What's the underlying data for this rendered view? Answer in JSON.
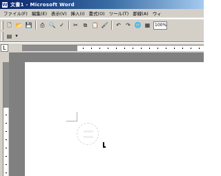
{
  "window": {
    "title": "文書1 - Microsoft Word",
    "app_icon": "word-app-icon"
  },
  "menu": {
    "items": [
      "ファイル(F)",
      "編集(E)",
      "表示(V)",
      "挿入(I)",
      "書式(O)",
      "ツール(T)",
      "罫線(A)",
      "ウィ"
    ]
  },
  "toolbar": {
    "standard_icons": [
      "new-document-icon",
      "open-folder-icon",
      "save-icon",
      "print-icon",
      "print-preview-icon",
      "spelling-icon",
      "cut-icon",
      "copy-icon",
      "paste-icon",
      "format-painter-icon",
      "undo-icon",
      "redo-icon",
      "hyperlink-icon",
      "table-icon"
    ],
    "zoom_value": "100%",
    "formatting_icons": [
      "style-icon",
      "dropdown-icon"
    ]
  },
  "ruler": {
    "tab_icon": "tab-selector-icon"
  },
  "colors": {
    "title_bar": "#0a246a",
    "chrome": "#d4d0c8",
    "workspace": "#808080",
    "page": "#ffffff"
  }
}
